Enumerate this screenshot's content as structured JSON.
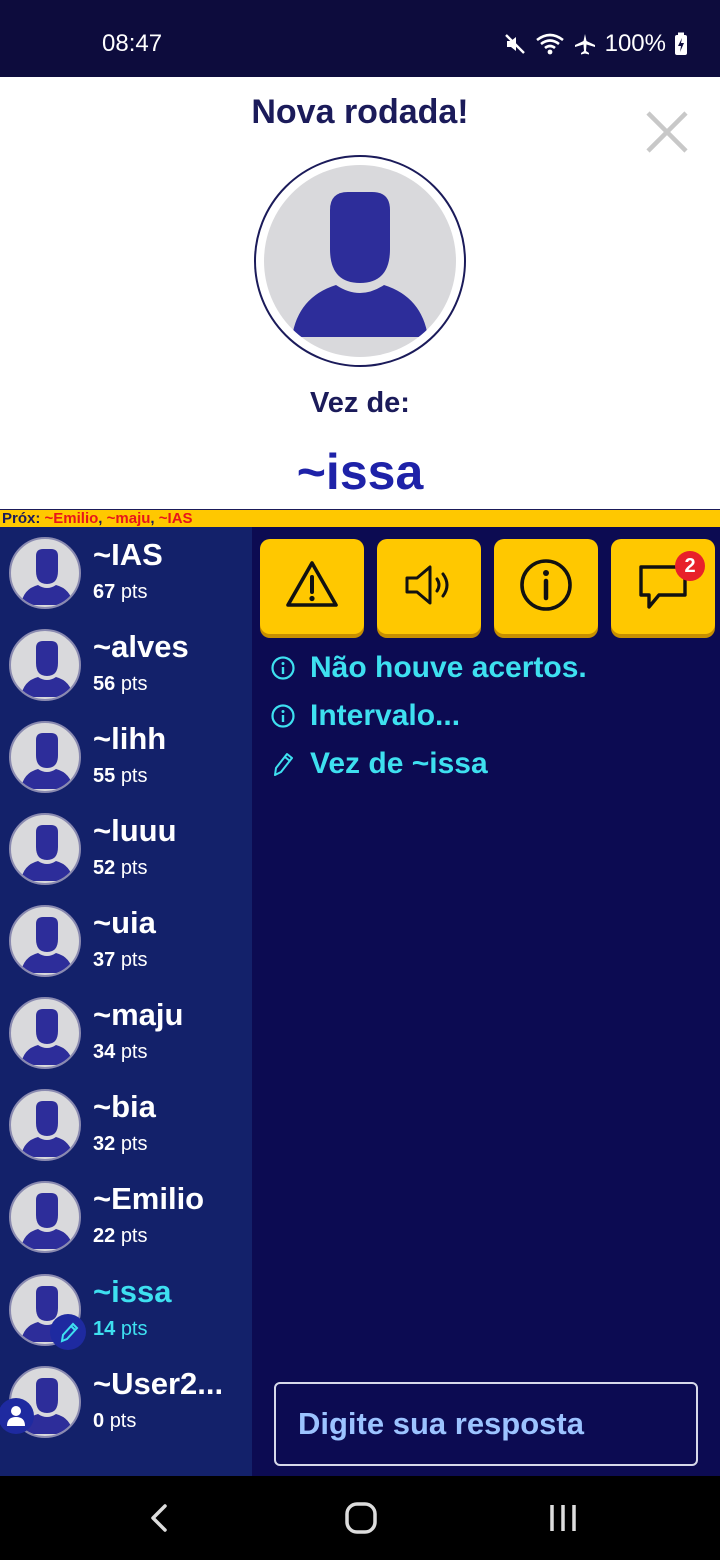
{
  "status_bar": {
    "time": "08:47",
    "battery": "100%"
  },
  "modal": {
    "title": "Nova rodada!",
    "turn_label": "Vez de:",
    "turn_player": "~issa"
  },
  "next_bar": {
    "label": "Próx:",
    "players": [
      "~Emilio",
      "~maju",
      "~IAS"
    ],
    "separator": ", "
  },
  "players": [
    {
      "name": "~IAS",
      "points": "67",
      "unit": "pts"
    },
    {
      "name": "~alves",
      "points": "56",
      "unit": "pts"
    },
    {
      "name": "~lihh",
      "points": "55",
      "unit": "pts"
    },
    {
      "name": "~luuu",
      "points": "52",
      "unit": "pts"
    },
    {
      "name": "~uia",
      "points": "37",
      "unit": "pts"
    },
    {
      "name": "~maju",
      "points": "34",
      "unit": "pts"
    },
    {
      "name": "~bia",
      "points": "32",
      "unit": "pts"
    },
    {
      "name": "~Emilio",
      "points": "22",
      "unit": "pts"
    },
    {
      "name": "~issa",
      "points": "14",
      "unit": "pts"
    },
    {
      "name": "~User2...",
      "points": "0",
      "unit": "pts"
    }
  ],
  "toolbar": {
    "buttons": [
      {
        "icon": "warning-icon"
      },
      {
        "icon": "speaker-icon"
      },
      {
        "icon": "info-icon"
      },
      {
        "icon": "chat-icon",
        "badge": "2"
      }
    ]
  },
  "messages": [
    {
      "icon": "info-circle-icon",
      "text": "Não houve acertos."
    },
    {
      "icon": "info-circle-icon",
      "text": "Intervalo..."
    },
    {
      "icon": "pencil-icon",
      "text": "Vez de ~issa"
    }
  ],
  "answer": {
    "placeholder": "Digite sua resposta"
  },
  "colors": {
    "accent": "#ffc800",
    "navy": "#0c0b52",
    "sidebar": "#13216a",
    "cyan": "#3ee0f0",
    "red": "#e8141a"
  }
}
